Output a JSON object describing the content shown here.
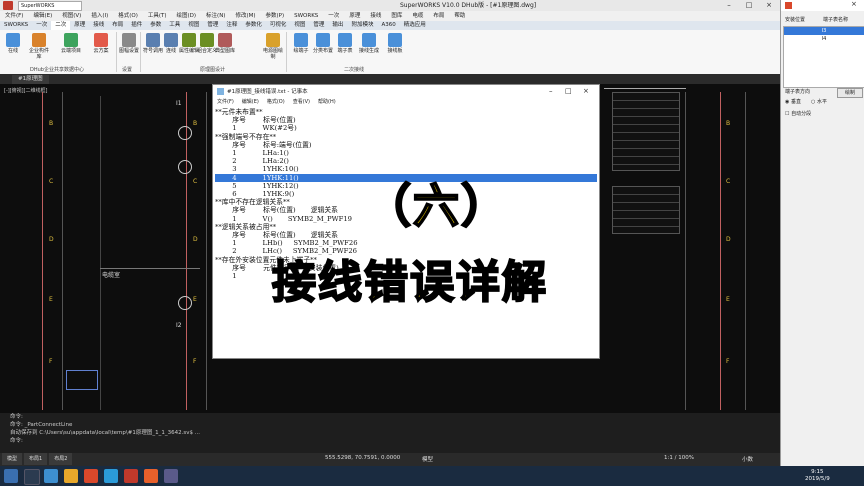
{
  "window": {
    "title": "SuperWORKS V10.0 DHub版 - [#1原理图.dwg]",
    "quick_access": "SuperWORKS"
  },
  "menu": [
    "文件(F)",
    "编辑(E)",
    "视图(V)",
    "插入(I)",
    "格式(O)",
    "工具(T)",
    "绘图(D)",
    "标注(N)",
    "修改(M)",
    "参数(P)",
    "SWORKS",
    "一次",
    "原理",
    "接线",
    "图库",
    "电缆",
    "布局",
    "帮助"
  ],
  "ribbon_tabs": [
    "SWORKS",
    "一次",
    "二次",
    "原理",
    "接线",
    "布局",
    "插件",
    "参数",
    "工具",
    "视图",
    "管理",
    "注释",
    "参数化",
    "可视化",
    "视图",
    "管理",
    "输出",
    "附加模块",
    "A360",
    "精选应用"
  ],
  "ribbon": {
    "buttons": [
      "在线",
      "企业构件库",
      "云端项目",
      "云方案",
      "图幅设置",
      "符号调用",
      "连线",
      "属性编辑",
      "组合定义",
      "典型图库",
      "电源图绘制",
      "绘端子",
      "分类布置",
      "端子表",
      "接线生成",
      "接线板"
    ],
    "groups": [
      "DHub企业共享数据中心",
      "设置",
      "原理图设计",
      "二次接线"
    ]
  },
  "doc_tab": "#1原理图",
  "view_label": "[-][俯视][二维线框]",
  "drawing": {
    "row_letters": [
      "B",
      "C",
      "D",
      "E",
      "F"
    ],
    "cabinet_label": "电缆室",
    "small_labels": [
      "I1",
      "I2"
    ]
  },
  "notepad": {
    "title": "#1原理图_接线错误.txt - 记事本",
    "menu": [
      "文件(F)",
      "编辑(E)",
      "格式(O)",
      "查看(V)",
      "帮助(H)"
    ],
    "lines": [
      "**元件未布置**",
      "        序号        标号(位置)",
      "        1            WK(#2号)",
      "**强制端号不存在**",
      "        序号        标号:端号(位置)",
      "        1            LHa:1()",
      "        2            LHa:2()",
      "        3            1YHK:10()",
      "        4            1YHK:11()",
      "        5            1YHK:12()",
      "        6            1YHK:9()",
      "**库中不存在逻辑关系**",
      "        序号        标号(位置)       逻辑关系",
      "        1            V()       SYMB2_M_PWF19",
      "**逻辑关系被占用**",
      "        序号        标号(位置)       逻辑关系",
      "        1            LHb()     SYMB2_M_PWF26",
      "        2            LHc()     SYMB2_M_PWF26",
      "**存在外安装位置元件未上端子**",
      "        序号        元件标号:端号(安装位置)",
      "        1"
    ]
  },
  "overlay": {
    "line1": "（六）",
    "line2": "接线错误详解"
  },
  "side_panel": {
    "col1": "安装位置",
    "col2": "端子表名称",
    "rows": [
      "I3",
      "I4"
    ],
    "direction_label": "端子表方向",
    "draw_button": "绘制",
    "vertical": "垂直",
    "horizontal": "水平",
    "auto_split": "自动分段"
  },
  "command": {
    "lines": [
      "命令:",
      "命令: _PartConnectLine",
      "自动保存到 C:\\Users\\su\\appdata\\local\\temp\\#1原理图_1_1_3642.sv$ ...",
      "命令:"
    ]
  },
  "model_tabs": [
    "模型",
    "布局1",
    "布局2"
  ],
  "status": {
    "coords": "555.5298, 70.7591, 0.0000",
    "mode": "模型",
    "scale": "1:1 / 100%",
    "units": "小数"
  },
  "clock": {
    "time": "9:15",
    "date": "2019/5/9"
  }
}
